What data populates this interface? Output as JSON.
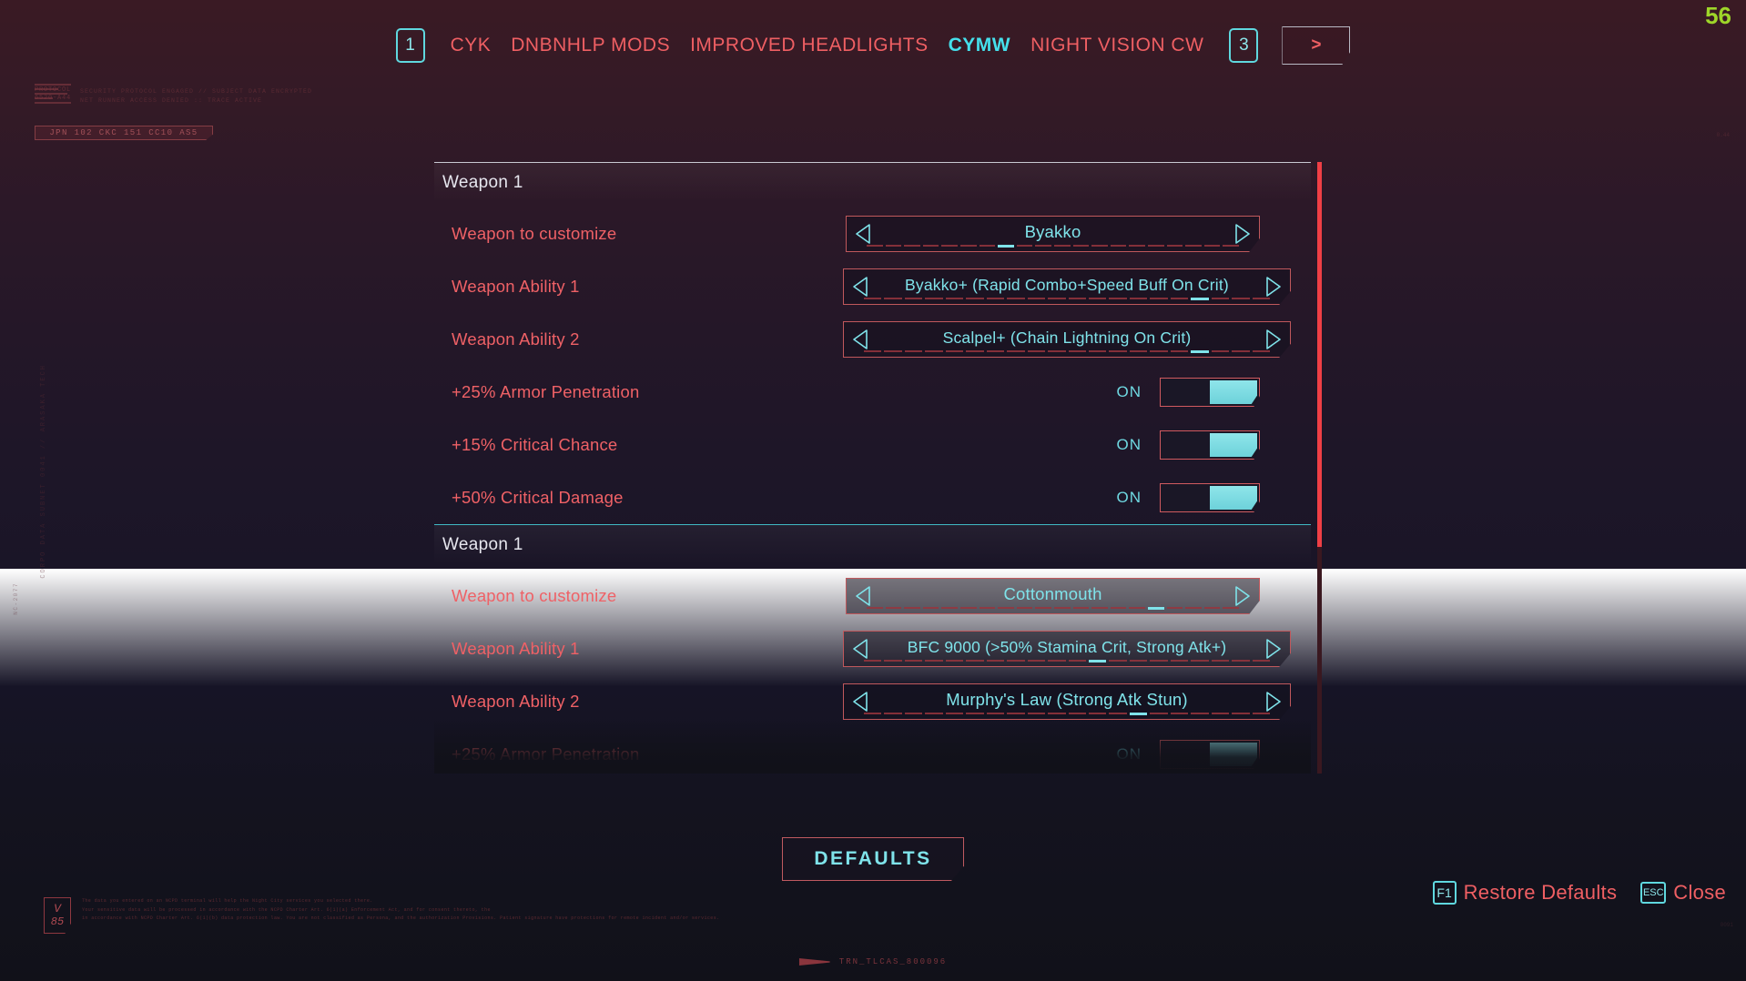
{
  "hud": {
    "fps": "56"
  },
  "tabbar": {
    "page_current": "1",
    "page_total": "3",
    "next_label": ">",
    "tabs": [
      {
        "label": "CYK",
        "active": false
      },
      {
        "label": "DNBNHLP MODS",
        "active": false
      },
      {
        "label": "IMPROVED HEADLIGHTS",
        "active": false
      },
      {
        "label": "CYMW",
        "active": true
      },
      {
        "label": "NIGHT VISION CW",
        "active": false
      }
    ]
  },
  "sections": [
    {
      "title": "Weapon 1",
      "accent": "grey",
      "rows": [
        {
          "kind": "selector",
          "label": "Weapon to customize",
          "value": "Byakko",
          "dash_index": 7,
          "dash_count": 20,
          "wide": false
        },
        {
          "kind": "selector",
          "label": "Weapon Ability 1",
          "value": "Byakko+ (Rapid Combo+Speed Buff On Crit)",
          "dash_index": 16,
          "dash_count": 20,
          "wide": true
        },
        {
          "kind": "selector",
          "label": "Weapon Ability 2",
          "value": "Scalpel+ (Chain Lightning On Crit)",
          "dash_index": 16,
          "dash_count": 20,
          "wide": true
        },
        {
          "kind": "toggle",
          "label": "+25% Armor Penetration",
          "state": "ON"
        },
        {
          "kind": "toggle",
          "label": "+15% Critical Chance",
          "state": "ON"
        },
        {
          "kind": "toggle",
          "label": "+50% Critical Damage",
          "state": "ON"
        }
      ]
    },
    {
      "title": "Weapon 1",
      "accent": "cyan",
      "rows": [
        {
          "kind": "selector",
          "label": "Weapon to customize",
          "value": "Cottonmouth",
          "dash_index": 15,
          "dash_count": 20,
          "wide": false
        },
        {
          "kind": "selector",
          "label": "Weapon Ability 1",
          "value": "BFC 9000 (>50% Stamina Crit, Strong Atk+)",
          "dash_index": 11,
          "dash_count": 20,
          "wide": true
        },
        {
          "kind": "selector",
          "label": "Weapon Ability 2",
          "value": "Murphy's Law (Strong Atk Stun)",
          "dash_index": 13,
          "dash_count": 20,
          "wide": true
        },
        {
          "kind": "toggle",
          "label": "+25% Armor Penetration",
          "state": "ON"
        }
      ]
    }
  ],
  "buttons": {
    "defaults": "DEFAULTS"
  },
  "footer": {
    "restore_key": "F1",
    "restore_label": "Restore Defaults",
    "close_key": "ESC",
    "close_label": "Close"
  },
  "decor": {
    "protocol": "PROTOCOL\n6520-A44",
    "protocol_body": "SECURITY PROTOCOL ENGAGED // SUBJECT DATA ENCRYPTED\nNET RUNNER ACCESS DENIED :: TRACE ACTIVE",
    "badge": "JPN 102 CKC 151 CC10 AS5",
    "vertical": "CORPO DATA SUBNET 0041 // ARASAKA TECH",
    "vertical2": "NC-2077",
    "tick_right": "0.44",
    "tick_right2": "0091",
    "version_top": "V",
    "version_bottom": "85",
    "legal": "The data you entered on an NCPD terminal will help the Night City services you selected there.\nYour sensitive data will be processed in accordance with the NCPD Charter Art. 6(1)(a) Enforcement Act, and for consent thereto, the\nin accordance with NCPD Charter Art. 6(1)(b) data protection law. You are not classified as Persona, and the authorization Provisions. Patient signature have protections for remote incident and/or services.",
    "trn": "TRN_TLCAS_800096"
  },
  "scroll": {
    "thumb_percent": "63"
  }
}
